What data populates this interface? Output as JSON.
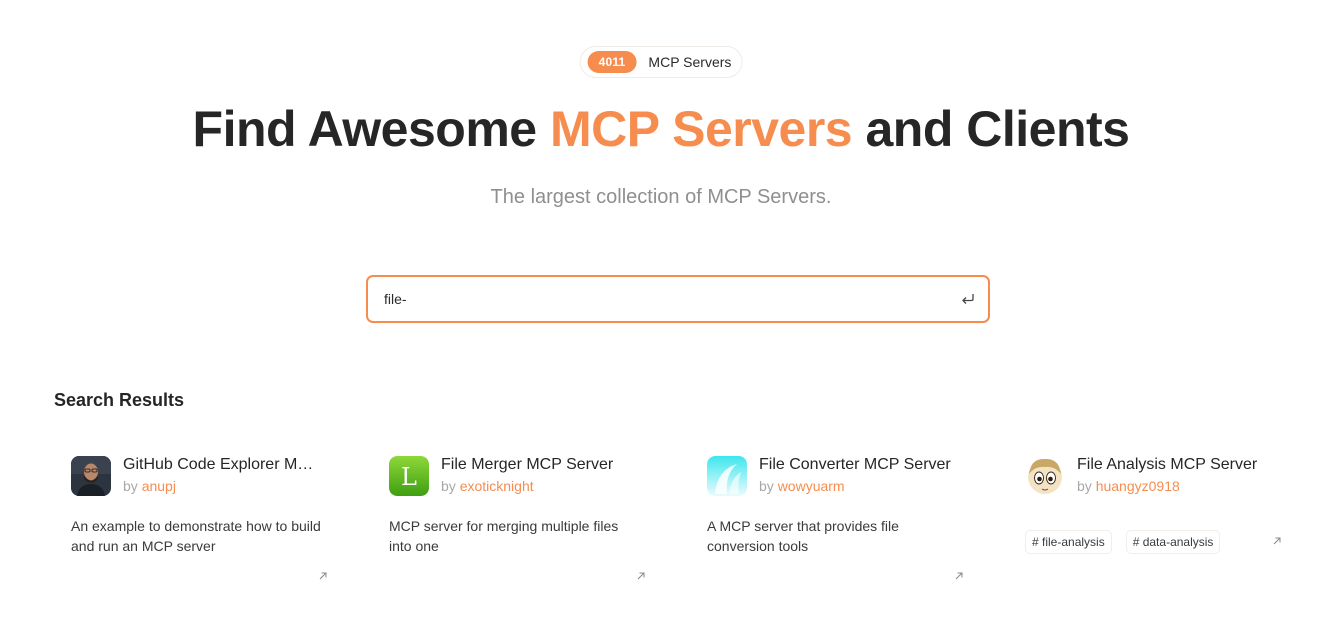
{
  "badge": {
    "count": "4011",
    "label": "MCP Servers"
  },
  "hero": {
    "title_pre": "Find Awesome ",
    "title_accent": "MCP Servers",
    "title_post": " and Clients",
    "subtitle": "The largest collection of MCP Servers."
  },
  "search": {
    "value": "file-"
  },
  "results": {
    "heading": "Search Results",
    "by_label": "by",
    "cards": [
      {
        "title": "GitHub Code Explorer MCP Server",
        "author": "anupj",
        "description": "An example to demonstrate how to build and run an MCP server",
        "avatar": "person-photo"
      },
      {
        "title": "File Merger MCP Server",
        "author": "exoticknight",
        "description": "MCP server for merging multiple files into one",
        "avatar": "green-L-logo",
        "avatar_letter": "L"
      },
      {
        "title": "File Converter MCP Server",
        "author": "wowyuarm",
        "description": "A MCP server that provides file conversion tools",
        "avatar": "cyan-gradient-logo"
      },
      {
        "title": "File Analysis MCP Server",
        "author": "huangyz0918",
        "avatar": "cartoon-face",
        "tags": [
          "# file-analysis",
          "# data-analysis"
        ]
      }
    ]
  },
  "colors": {
    "accent": "#f68d4f",
    "heading": "#262626",
    "muted": "#8f8f8f"
  }
}
